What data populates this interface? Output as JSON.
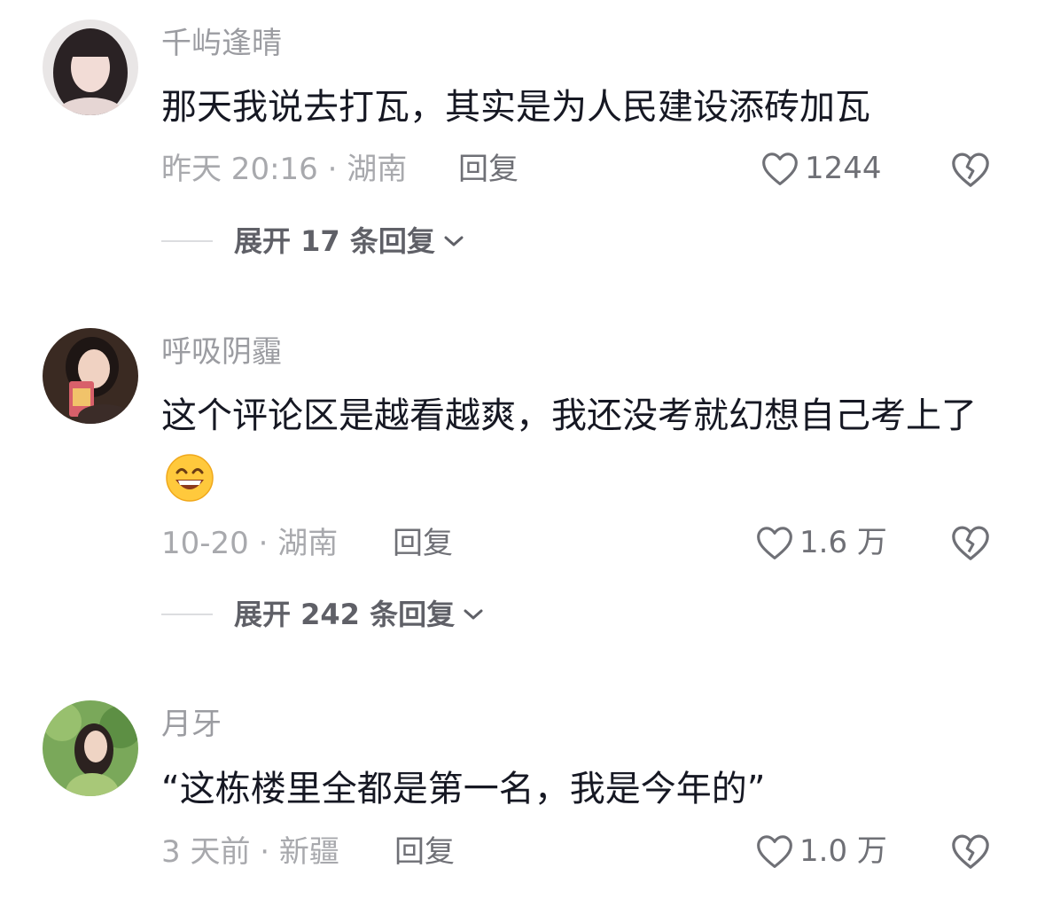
{
  "comments": [
    {
      "username": "千屿逢晴",
      "content": "那天我说去打瓦，其实是为人民建设添砖加瓦",
      "time_location": "昨天 20:16 · 湖南",
      "reply_label": "回复",
      "likes": "1244",
      "expand_label": "展开 17 条回复"
    },
    {
      "username": "呼吸阴霾",
      "content": "这个评论区是越看越爽，我还没考就幻想自己考上了",
      "time_location": "10-20 · 湖南",
      "reply_label": "回复",
      "likes": "1.6 万",
      "expand_label": "展开 242 条回复"
    },
    {
      "username": "月牙",
      "content": "“这栋楼里全都是第一名，我是今年的”",
      "time_location": "3 天前 · 新疆",
      "reply_label": "回复",
      "likes": "1.0 万"
    }
  ],
  "icons": {
    "like": "heart-outline-icon",
    "dislike": "broken-heart-icon",
    "expand": "chevron-down-icon",
    "emoji": "grinning-face-emoji"
  },
  "colors": {
    "text_primary": "#161823",
    "text_secondary": "#9b9ca1",
    "action_gray": "#6f7076",
    "background": "#ffffff"
  }
}
